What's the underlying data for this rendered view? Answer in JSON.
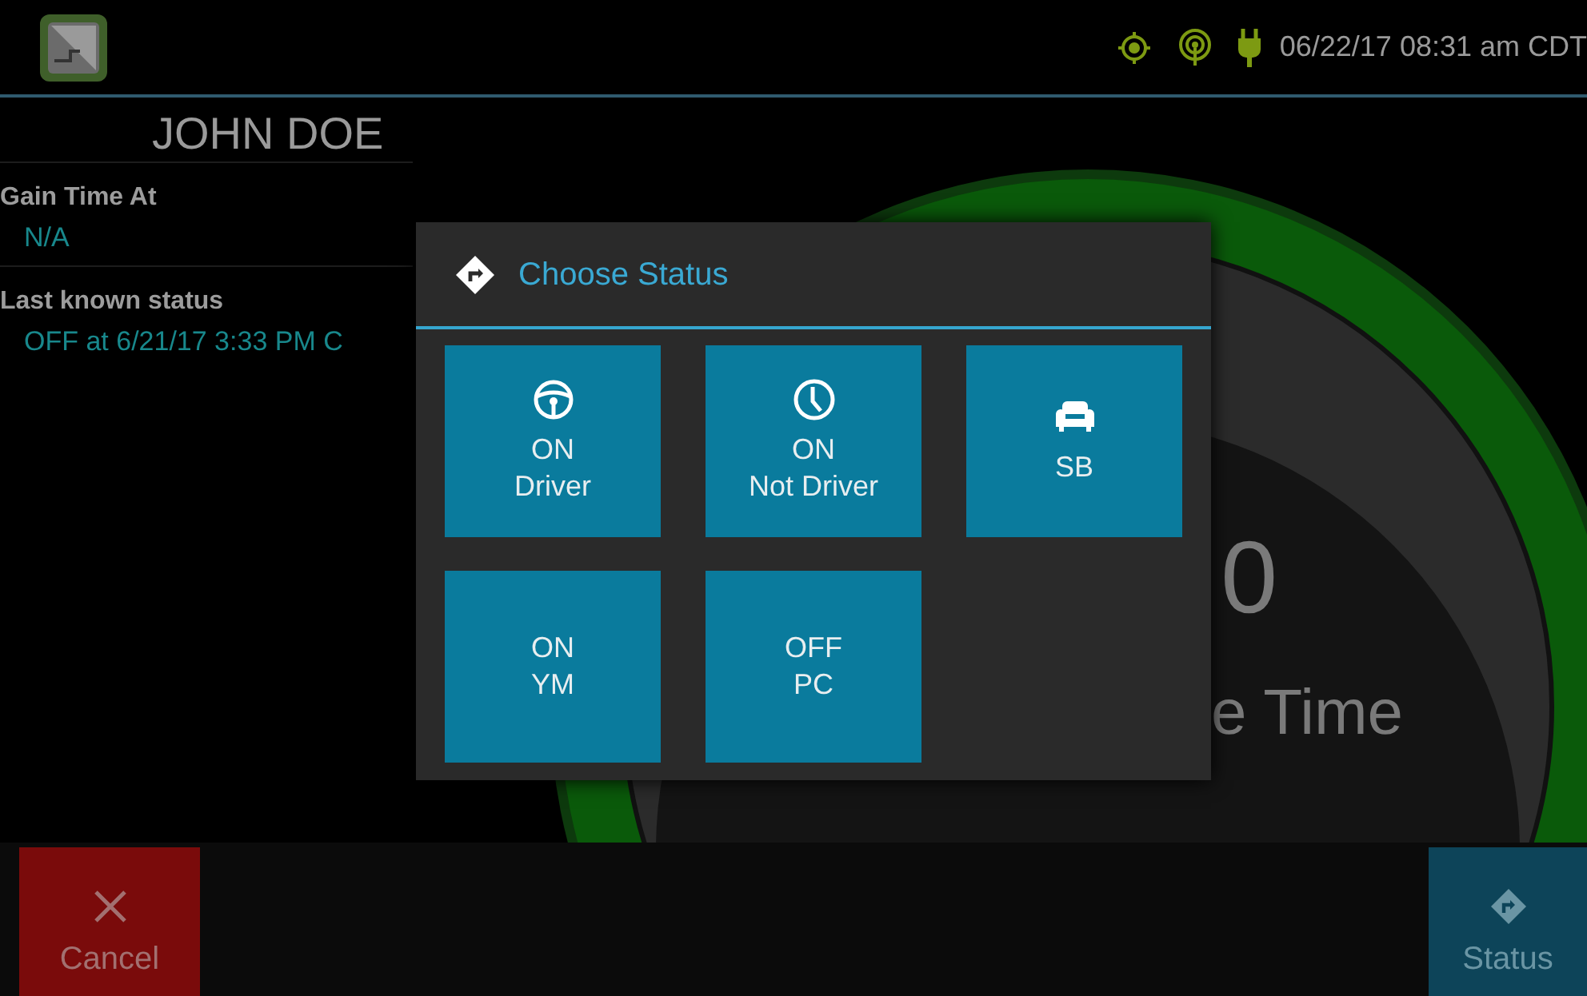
{
  "header": {
    "datetime": "06/22/17 08:31 am CDT"
  },
  "driver": {
    "name": "JOHN DOE"
  },
  "fields": [
    {
      "label": "Gain Time At",
      "value": "N/A"
    },
    {
      "label": "Last known status",
      "value": "OFF at 6/21/17 3:33 PM C"
    }
  ],
  "gauge": {
    "value": "0",
    "caption": "e Time"
  },
  "dialog": {
    "title": "Choose Status",
    "options": [
      {
        "kind": "driving",
        "lines": [
          "ON",
          "Driver"
        ]
      },
      {
        "kind": "onduty",
        "lines": [
          "ON",
          "Not Driver"
        ]
      },
      {
        "kind": "sleeper",
        "lines": [
          "SB"
        ]
      },
      {
        "kind": "yard",
        "lines": [
          "ON",
          "YM"
        ]
      },
      {
        "kind": "personal",
        "lines": [
          "OFF",
          "PC"
        ]
      }
    ]
  },
  "footer": [
    {
      "kind": "cancel",
      "label": "Cancel"
    },
    {
      "kind": "status",
      "label": "Status"
    }
  ]
}
